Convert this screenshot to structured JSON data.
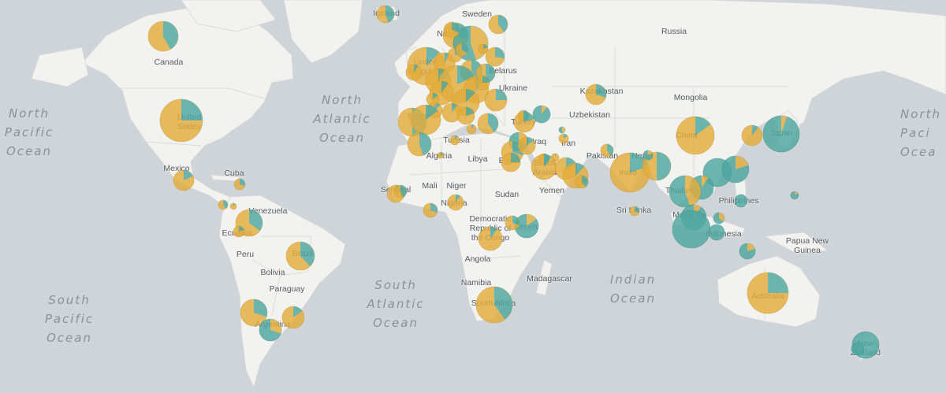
{
  "colors": {
    "ocean": "#cfd4d8",
    "land": "#f2f2f1",
    "border": "#d8d8d8",
    "slice_a": "#e3ad3c",
    "slice_b": "#4fa7a0"
  },
  "ocean_labels": [
    {
      "lines": [
        "North",
        "Pacific",
        "Ocean"
      ]
    },
    {
      "lines": [
        "North",
        "Atlantic",
        "Ocean"
      ]
    },
    {
      "lines": [
        "North",
        "Paci",
        "Ocea"
      ]
    },
    {
      "lines": [
        "South",
        "Atlantic",
        "Ocean"
      ]
    },
    {
      "lines": [
        "Indian",
        "Ocean"
      ]
    },
    {
      "lines": [
        "South",
        "Pacific",
        "Ocean"
      ]
    }
  ],
  "country_labels": [
    "Canada",
    "United States",
    "Mexico",
    "Cuba",
    "Venezuela",
    "Ecuador",
    "Peru",
    "Brazil",
    "Bolivia",
    "Paraguay",
    "Argentina",
    "Iceland",
    "Sweden",
    "Norway",
    "United Kingdom",
    "Belarus",
    "Ukraine",
    "Spain",
    "Tunisia",
    "Algeria",
    "Libya",
    "Egypt",
    "Mali",
    "Niger",
    "Nigeria",
    "Senegal",
    "Sudan",
    "Democratic Republic of the Congo",
    "Kenya",
    "Angola",
    "Namibia",
    "South Africa",
    "Madagascar",
    "Turkey",
    "Iraq",
    "Iran",
    "Saudi Arabia",
    "Yemen",
    "Russia",
    "Kazakhstan",
    "Mongolia",
    "Uzbekistan",
    "Pakistan",
    "Nepal",
    "India",
    "Sri Lanka",
    "China",
    "Japan",
    "Thailand",
    "Malaysia",
    "Philippines",
    "Indonesia",
    "Papua New Guinea",
    "Australia",
    "New Zealand"
  ],
  "markers": [
    {
      "share": 0.58
    },
    {
      "share": 0.75
    },
    {
      "share": 0.82
    },
    {
      "share": 0.7
    },
    {
      "share": 0.6
    },
    {
      "share": 0.88
    },
    {
      "share": 0.65
    },
    {
      "share": 0.8
    },
    {
      "share": 0.62
    },
    {
      "share": 0.7
    },
    {
      "share": 0.85
    },
    {
      "share": 0.3
    },
    {
      "share": 0.55
    },
    {
      "share": 0.7
    },
    {
      "share": 0.45
    },
    {
      "share": 0.6
    },
    {
      "share": 0.72
    },
    {
      "share": 0.88
    },
    {
      "share": 0.9
    },
    {
      "share": 0.92
    },
    {
      "share": 0.78
    },
    {
      "share": 0.6
    },
    {
      "share": 0.55
    },
    {
      "share": 0.8
    },
    {
      "share": 0.82
    },
    {
      "share": 0.92
    },
    {
      "share": 0.75
    },
    {
      "share": 0.9
    },
    {
      "share": 0.88
    },
    {
      "share": 0.86
    },
    {
      "share": 0.9
    },
    {
      "share": 0.8
    },
    {
      "share": 0.5
    },
    {
      "share": 0.85
    },
    {
      "share": 0.55
    },
    {
      "share": 0.9
    },
    {
      "share": 0.8
    },
    {
      "share": 0.6
    },
    {
      "share": 0.8
    },
    {
      "share": 0.1
    },
    {
      "share": 0.3
    },
    {
      "share": 0.7
    },
    {
      "share": 0.85
    },
    {
      "share": 0.5
    },
    {
      "share": 0.95
    },
    {
      "share": 0.85
    },
    {
      "share": 0.9
    },
    {
      "share": 0.8
    },
    {
      "share": 0.88
    },
    {
      "share": 0.75
    },
    {
      "share": 0.6
    },
    {
      "share": 0.7
    },
    {
      "share": 0.8
    },
    {
      "share": 0.5
    },
    {
      "share": 0.2
    },
    {
      "share": 0.7
    },
    {
      "share": 0.9
    },
    {
      "share": 0.7
    },
    {
      "share": 0.85
    },
    {
      "share": 0.55
    },
    {
      "share": 0.9
    },
    {
      "share": 0.15
    },
    {
      "share": 0.7
    },
    {
      "share": 0.6
    },
    {
      "share": 0.85
    },
    {
      "share": 0.9
    },
    {
      "share": 0.05
    },
    {
      "share": 0.0
    },
    {
      "share": 0.2
    },
    {
      "share": 0.1
    },
    {
      "share": 0.45
    },
    {
      "share": 0.1
    },
    {
      "share": 0.0
    },
    {
      "share": 0.35
    },
    {
      "share": 0.0
    },
    {
      "share": 0.0
    },
    {
      "share": 0.2
    },
    {
      "share": 0.15
    },
    {
      "share": 0.75
    },
    {
      "share": 0.0
    },
    {
      "share": 0.0
    },
    {
      "share": 0.45
    },
    {
      "share": 0.6
    },
    {
      "share": 0.5
    },
    {
      "share": 0.9
    },
    {
      "share": 0.75
    },
    {
      "share": 0.85
    },
    {
      "share": 0.65
    },
    {
      "share": 0.8
    },
    {
      "share": 0.7
    },
    {
      "share": 0.75
    },
    {
      "share": 0.95
    },
    {
      "share": 0.55
    },
    {
      "share": 0.75
    },
    {
      "share": 0.9
    },
    {
      "share": 0.25
    },
    {
      "share": 0.9
    },
    {
      "share": 0.6
    },
    {
      "share": 0.4
    },
    {
      "share": 0.9
    },
    {
      "share": 0.85
    },
    {
      "share": 0.65
    },
    {
      "share": 0.8
    },
    {
      "share": 0.75
    },
    {
      "share": 0.85
    }
  ]
}
